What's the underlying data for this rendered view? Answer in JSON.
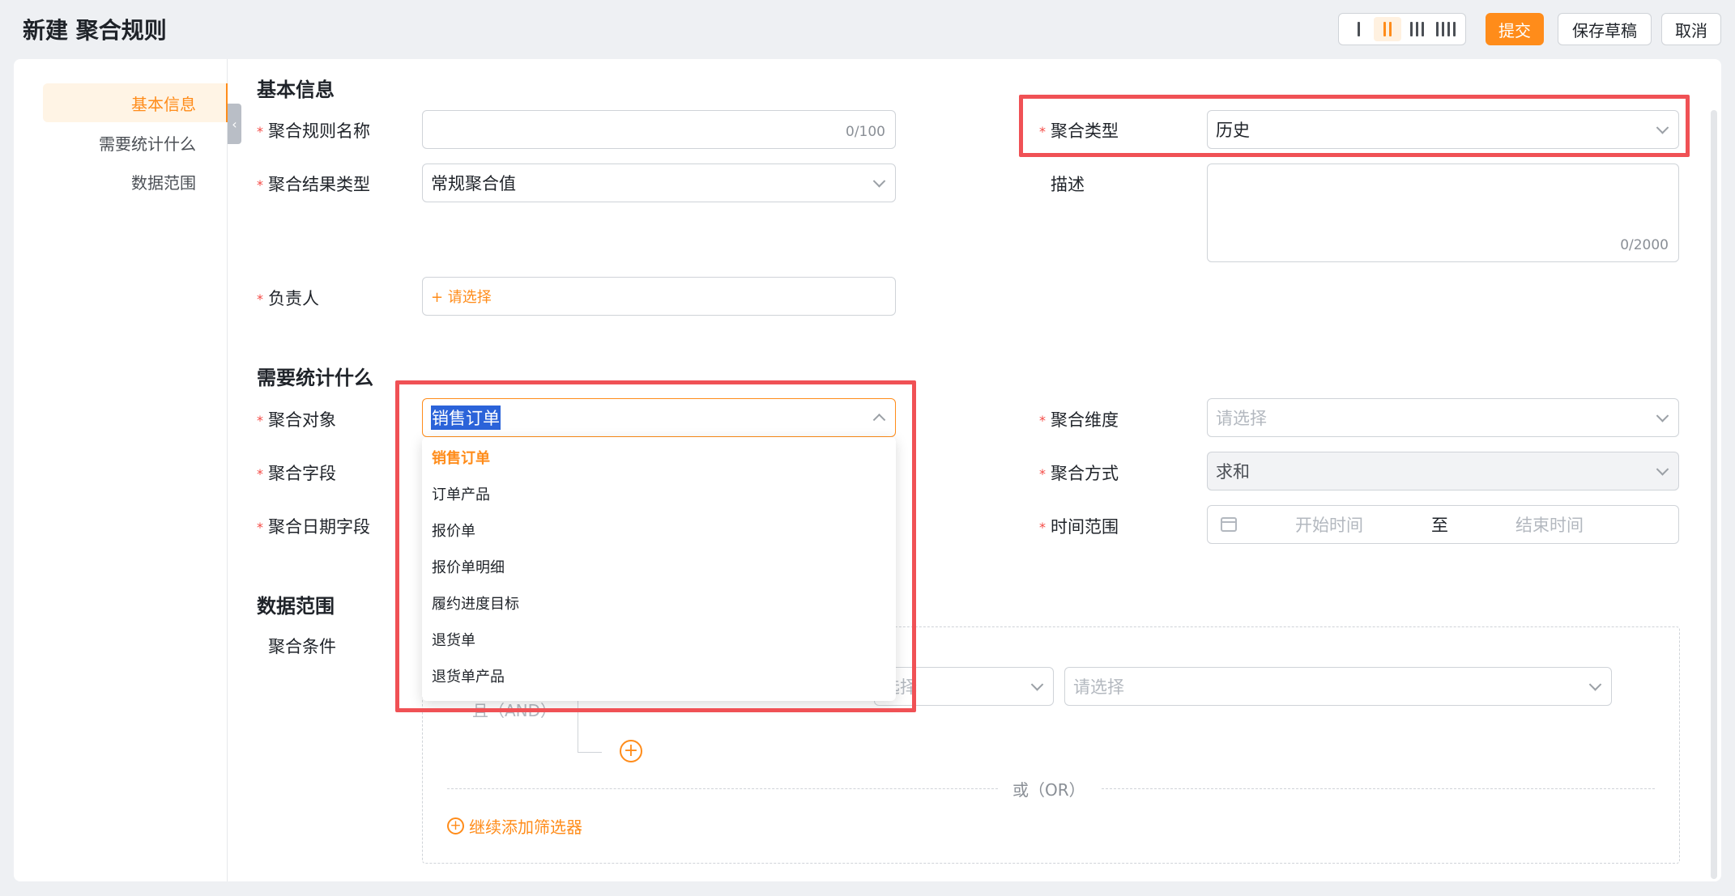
{
  "header": {
    "title": "新建 聚合规则",
    "submit": "提交",
    "save_draft": "保存草稿",
    "cancel": "取消",
    "layout_options": [
      "1列",
      "2列",
      "3列",
      "4列"
    ]
  },
  "nav": {
    "items": [
      "基本信息",
      "需要统计什么",
      "数据范围"
    ],
    "active": "基本信息"
  },
  "sections": {
    "basic": "基本信息",
    "what": "需要统计什么",
    "range": "数据范围"
  },
  "basic": {
    "rule_name_label": "聚合规则名称",
    "rule_name_value": "",
    "rule_name_count": "0/100",
    "result_type_label": "聚合结果类型",
    "result_type_value": "常规聚合值",
    "owner_label": "负责人",
    "owner_placeholder": "+ 请选择",
    "agg_type_label": "聚合类型",
    "agg_type_value": "历史",
    "desc_label": "描述",
    "desc_count": "0/2000"
  },
  "what": {
    "object_label": "聚合对象",
    "object_value": "销售订单",
    "field_label": "聚合字段",
    "date_field_label": "聚合日期字段",
    "dimension_label": "聚合维度",
    "dimension_placeholder": "请选择",
    "method_label": "聚合方式",
    "method_value": "求和",
    "time_range_label": "时间范围",
    "start_placeholder": "开始时间",
    "to": "至",
    "end_placeholder": "结束时间"
  },
  "dropdown": {
    "options": [
      "销售订单",
      "订单产品",
      "报价单",
      "报价单明细",
      "履约进度目标",
      "退货单",
      "退货单产品"
    ],
    "selected": "销售订单"
  },
  "range": {
    "condition_label": "聚合条件",
    "and_label": "且（AND）",
    "select_placeholder_partial": "选择",
    "select_placeholder": "请选择",
    "or_label": "或（OR）",
    "add_filter": "继续添加筛选器"
  },
  "colors": {
    "accent": "#ff8c1a",
    "highlight": "#f05155",
    "required": "#f54a45"
  }
}
